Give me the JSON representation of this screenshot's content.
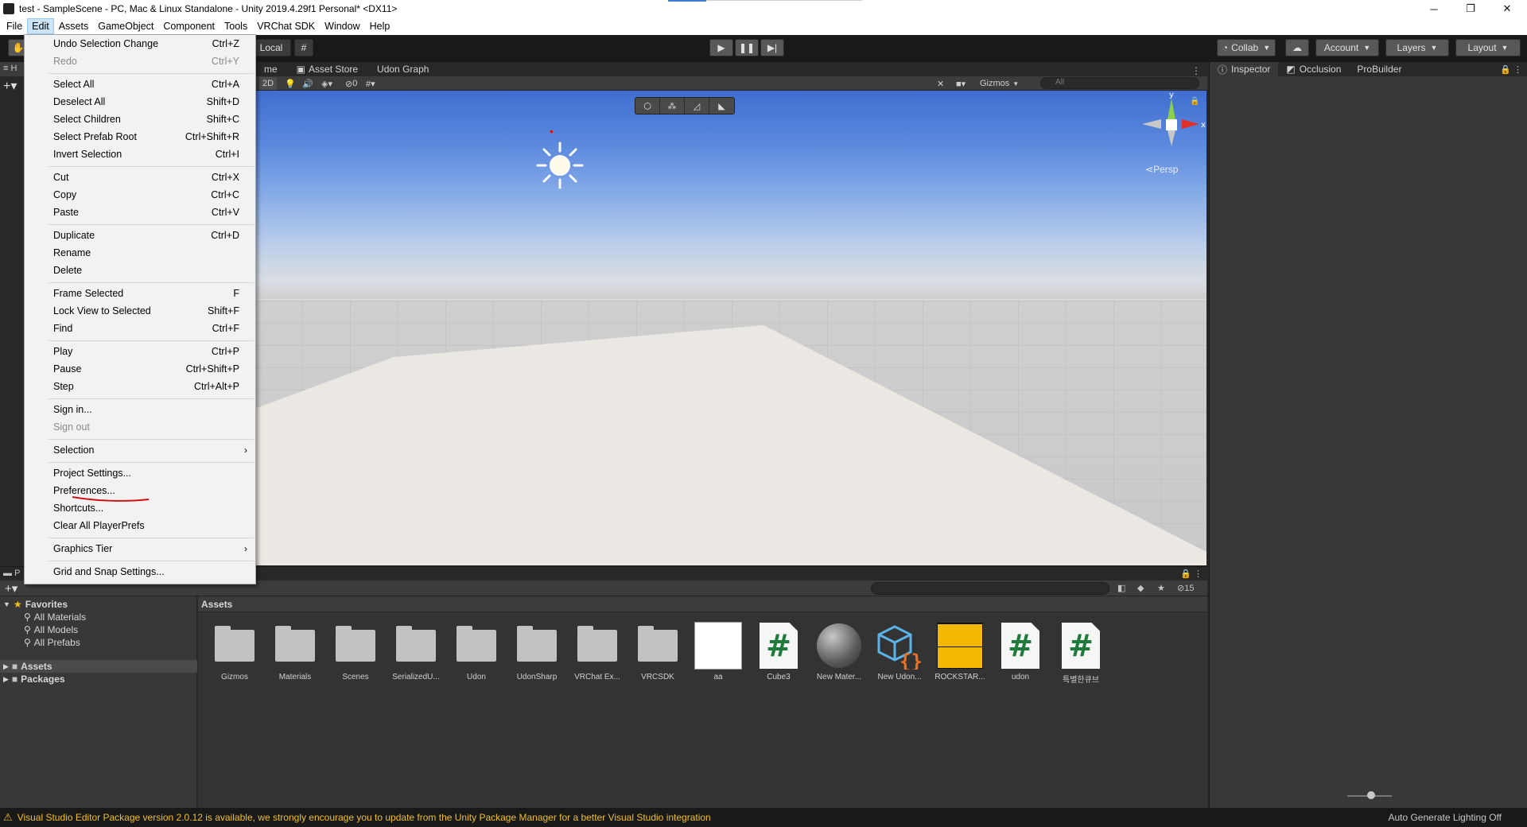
{
  "window": {
    "title": "test - SampleScene - PC, Mac & Linux Standalone - Unity 2019.4.29f1 Personal* <DX11>",
    "controls": [
      "─",
      "❐",
      "✕"
    ]
  },
  "menubar": [
    "File",
    "Edit",
    "Assets",
    "GameObject",
    "Component",
    "Tools",
    "VRChat SDK",
    "Window",
    "Help"
  ],
  "toolbar": {
    "pivot_label": "Local",
    "collab_label": "Collab",
    "account_label": "Account",
    "layers_label": "Layers",
    "layout_label": "Layout"
  },
  "scene_tabs": [
    "me",
    "Asset Store",
    "Udon Graph"
  ],
  "scene_toolbar": {
    "mode_2d": "2D",
    "hidden_count": "0",
    "gizmos_label": "Gizmos",
    "search_placeholder": "All"
  },
  "viewport": {
    "persp_label": "Persp",
    "axis_y": "y",
    "axis_x": "x"
  },
  "hierarchy_tab": "H",
  "inspector_tabs": [
    "Inspector",
    "Occlusion",
    "ProBuilder"
  ],
  "project": {
    "tab_label": "P",
    "hidden_count": "15",
    "breadcrumb": "Assets",
    "favorites": {
      "label": "Favorites",
      "items": [
        "All Materials",
        "All Models",
        "All Prefabs"
      ]
    },
    "roots": [
      "Assets",
      "Packages"
    ],
    "assets": [
      {
        "name": "Gizmos",
        "kind": "folder"
      },
      {
        "name": "Materials",
        "kind": "folder"
      },
      {
        "name": "Scenes",
        "kind": "folder"
      },
      {
        "name": "SerializedU...",
        "kind": "folder"
      },
      {
        "name": "Udon",
        "kind": "folder"
      },
      {
        "name": "UdonSharp",
        "kind": "folder"
      },
      {
        "name": "VRChat Ex...",
        "kind": "folder"
      },
      {
        "name": "VRCSDK",
        "kind": "folder"
      },
      {
        "name": "aa",
        "kind": "image"
      },
      {
        "name": "Cube3",
        "kind": "script"
      },
      {
        "name": "New Mater...",
        "kind": "material"
      },
      {
        "name": "New Udon...",
        "kind": "udon"
      },
      {
        "name": "ROCKSTAR...",
        "kind": "texture"
      },
      {
        "name": "udon",
        "kind": "script"
      },
      {
        "name": "특별한큐브",
        "kind": "script"
      }
    ]
  },
  "edit_menu": [
    {
      "label": "Undo Selection Change",
      "shortcut": "Ctrl+Z"
    },
    {
      "label": "Redo",
      "shortcut": "Ctrl+Y",
      "disabled": true
    },
    {
      "label": "Select All",
      "shortcut": "Ctrl+A"
    },
    {
      "label": "Deselect All",
      "shortcut": "Shift+D"
    },
    {
      "label": "Select Children",
      "shortcut": "Shift+C"
    },
    {
      "label": "Select Prefab Root",
      "shortcut": "Ctrl+Shift+R"
    },
    {
      "label": "Invert Selection",
      "shortcut": "Ctrl+I"
    },
    {
      "label": "Cut",
      "shortcut": "Ctrl+X"
    },
    {
      "label": "Copy",
      "shortcut": "Ctrl+C"
    },
    {
      "label": "Paste",
      "shortcut": "Ctrl+V"
    },
    {
      "label": "Duplicate",
      "shortcut": "Ctrl+D"
    },
    {
      "label": "Rename",
      "shortcut": ""
    },
    {
      "label": "Delete",
      "shortcut": ""
    },
    {
      "label": "Frame Selected",
      "shortcut": "F"
    },
    {
      "label": "Lock View to Selected",
      "shortcut": "Shift+F"
    },
    {
      "label": "Find",
      "shortcut": "Ctrl+F"
    },
    {
      "label": "Play",
      "shortcut": "Ctrl+P"
    },
    {
      "label": "Pause",
      "shortcut": "Ctrl+Shift+P"
    },
    {
      "label": "Step",
      "shortcut": "Ctrl+Alt+P"
    },
    {
      "label": "Sign in...",
      "shortcut": ""
    },
    {
      "label": "Sign out",
      "shortcut": "",
      "disabled": true
    },
    {
      "label": "Selection",
      "shortcut": "",
      "submenu": true
    },
    {
      "label": "Project Settings...",
      "shortcut": ""
    },
    {
      "label": "Preferences...",
      "shortcut": ""
    },
    {
      "label": "Shortcuts...",
      "shortcut": ""
    },
    {
      "label": "Clear All PlayerPrefs",
      "shortcut": ""
    },
    {
      "label": "Graphics Tier",
      "shortcut": "",
      "submenu": true
    },
    {
      "label": "Grid and Snap Settings...",
      "shortcut": ""
    }
  ],
  "statusbar": {
    "message": "Visual Studio Editor Package version 2.0.12 is available, we strongly encourage you to update from the Unity Package Manager for a better Visual Studio integration",
    "right": "Auto Generate Lighting Off"
  },
  "colors": {
    "editor_bg": "#282828",
    "menu_bg": "#f2f2f2",
    "warning": "#f0c020",
    "annotation": "#d01010"
  }
}
